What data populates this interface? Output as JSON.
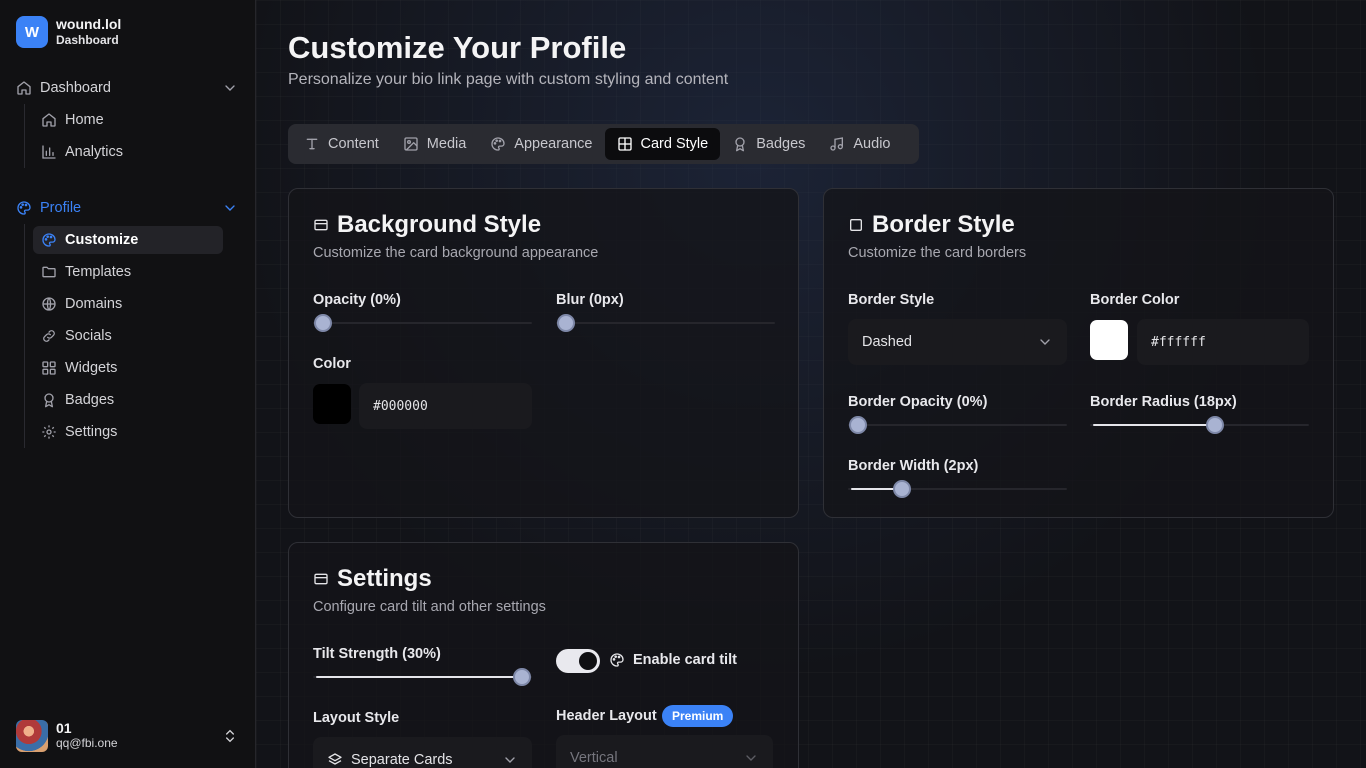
{
  "brand": {
    "logo_letter": "W",
    "name": "wound.lol",
    "subtitle": "Dashboard"
  },
  "sidebar": {
    "groups": [
      {
        "label": "Dashboard",
        "icon": "home-icon",
        "items": [
          {
            "label": "Home",
            "icon": "home-icon"
          },
          {
            "label": "Analytics",
            "icon": "bar-chart-icon"
          }
        ]
      },
      {
        "label": "Profile",
        "icon": "palette-icon",
        "items": [
          {
            "label": "Customize",
            "icon": "palette-icon",
            "active": true
          },
          {
            "label": "Templates",
            "icon": "folder-icon"
          },
          {
            "label": "Domains",
            "icon": "globe-icon"
          },
          {
            "label": "Socials",
            "icon": "link-icon"
          },
          {
            "label": "Widgets",
            "icon": "grid-icon"
          },
          {
            "label": "Badges",
            "icon": "award-icon"
          },
          {
            "label": "Settings",
            "icon": "gear-icon"
          }
        ]
      }
    ]
  },
  "user": {
    "name": "01",
    "email": "qq@fbi.one"
  },
  "page": {
    "title": "Customize Your Profile",
    "subtitle": "Personalize your bio link page with custom styling and content"
  },
  "tabs": [
    {
      "label": "Content",
      "icon": "text-icon"
    },
    {
      "label": "Media",
      "icon": "image-icon"
    },
    {
      "label": "Appearance",
      "icon": "palette-icon"
    },
    {
      "label": "Card Style",
      "icon": "layout-icon",
      "active": true
    },
    {
      "label": "Badges",
      "icon": "award-icon"
    },
    {
      "label": "Audio",
      "icon": "music-icon"
    }
  ],
  "background_style": {
    "title": "Background Style",
    "subtitle": "Customize the card background appearance",
    "opacity_label": "Opacity (0%)",
    "opacity_value": 0,
    "blur_label": "Blur (0px)",
    "blur_value": 0,
    "color_label": "Color",
    "color_hex": "#000000"
  },
  "border_style": {
    "title": "Border Style",
    "subtitle": "Customize the card borders",
    "style_label": "Border Style",
    "style_value": "Dashed",
    "color_label": "Border Color",
    "color_hex": "#ffffff",
    "opacity_label": "Border Opacity (0%)",
    "opacity_value": 0,
    "radius_label": "Border Radius (18px)",
    "radius_value": 0.58,
    "width_label": "Border Width (2px)",
    "width_value": 0.22
  },
  "settings": {
    "title": "Settings",
    "subtitle": "Configure card tilt and other settings",
    "tilt_label": "Tilt Strength (30%)",
    "tilt_value": 1.0,
    "tilt_toggle_label": "Enable card tilt",
    "tilt_enabled": true,
    "layout_label": "Layout Style",
    "layout_value": "Separate Cards",
    "header_label": "Header Layout",
    "header_badge": "Premium",
    "header_value": "Vertical"
  },
  "colors": {
    "accent": "#3b82f6",
    "active_nav_bg": "#232328",
    "thumb": "#a9b3d2"
  }
}
